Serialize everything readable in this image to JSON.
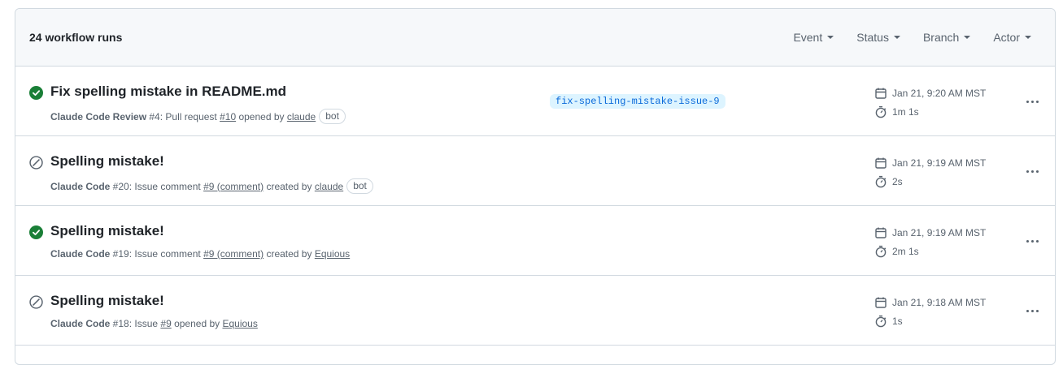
{
  "header": {
    "runs_count": "24 workflow runs",
    "filters": [
      {
        "label": "Event"
      },
      {
        "label": "Status"
      },
      {
        "label": "Branch"
      },
      {
        "label": "Actor"
      }
    ]
  },
  "runs": [
    {
      "status": "success",
      "title": "Fix spelling mistake in README.md",
      "workflow": "Claude Code Review",
      "run_number": " #4",
      "event_prefix": ": Pull request ",
      "ref_link": "#10",
      "action_text": " opened by ",
      "actor": "claude",
      "actor_badge": "bot",
      "branch": "fix-spelling-mistake-issue-9",
      "date": "Jan 21, 9:20 AM MST",
      "duration": "1m 1s"
    },
    {
      "status": "skipped",
      "title": "Spelling mistake!",
      "workflow": "Claude Code",
      "run_number": " #20",
      "event_prefix": ": Issue comment ",
      "ref_link": "#9 (comment)",
      "action_text": " created by ",
      "actor": "claude",
      "actor_badge": "bot",
      "branch": "",
      "date": "Jan 21, 9:19 AM MST",
      "duration": "2s"
    },
    {
      "status": "success",
      "title": "Spelling mistake!",
      "workflow": "Claude Code",
      "run_number": " #19",
      "event_prefix": ": Issue comment ",
      "ref_link": "#9 (comment)",
      "action_text": " created by ",
      "actor": "Equious",
      "actor_badge": "",
      "branch": "",
      "date": "Jan 21, 9:19 AM MST",
      "duration": "2m 1s"
    },
    {
      "status": "skipped",
      "title": "Spelling mistake!",
      "workflow": "Claude Code",
      "run_number": " #18",
      "event_prefix": ": Issue ",
      "ref_link": "#9",
      "action_text": " opened by ",
      "actor": "Equious",
      "actor_badge": "",
      "branch": "",
      "date": "Jan 21, 9:18 AM MST",
      "duration": "1s"
    }
  ],
  "colors": {
    "success": "#1a7f37",
    "skipped": "#59636e",
    "branch_bg": "#ddf4ff",
    "branch_fg": "#0969da"
  }
}
